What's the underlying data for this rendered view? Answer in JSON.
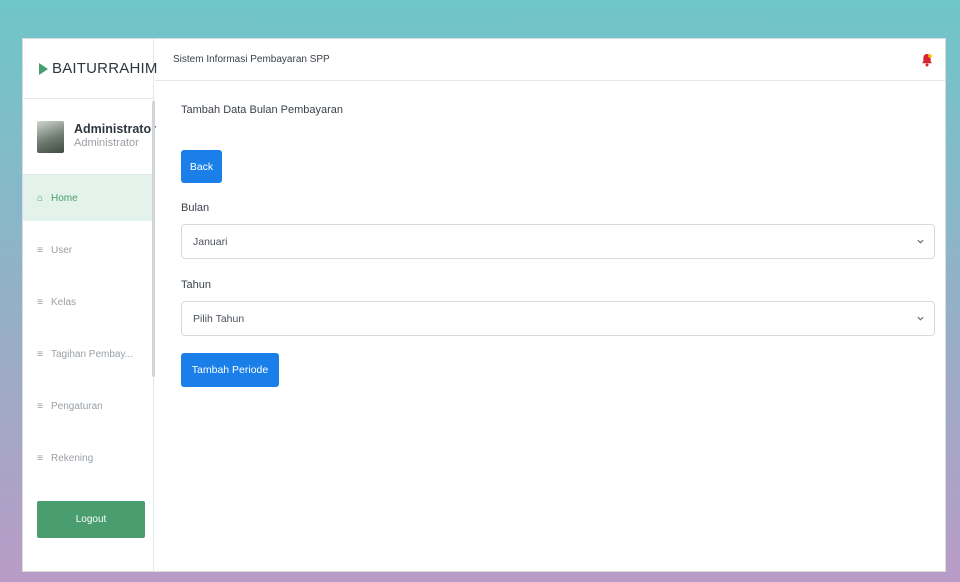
{
  "sidebar": {
    "brand": "BAITURRAHIM",
    "profile": {
      "name": "Administrator",
      "role": "Administrator"
    },
    "items": [
      {
        "label": "Home",
        "icon": "home-icon",
        "active": true
      },
      {
        "label": "User",
        "icon": "menu-lines-icon",
        "active": false
      },
      {
        "label": "Kelas",
        "icon": "menu-lines-icon",
        "active": false
      },
      {
        "label": "Tagihan Pembay...",
        "icon": "menu-lines-icon",
        "active": false
      },
      {
        "label": "Pengaturan",
        "icon": "menu-lines-icon",
        "active": false
      },
      {
        "label": "Rekening",
        "icon": "menu-lines-icon",
        "active": false
      }
    ],
    "logout_label": "Logout"
  },
  "topbar": {
    "title": "Sistem Informasi Pembayaran SPP",
    "notification_icon": "bell-icon"
  },
  "main": {
    "page_title": "Tambah Data Bulan Pembayaran",
    "back_label": "Back",
    "fields": {
      "bulan": {
        "label": "Bulan",
        "value": "Januari"
      },
      "tahun": {
        "label": "Tahun",
        "value": "Pilih Tahun"
      }
    },
    "submit_label": "Tambah Periode"
  },
  "colors": {
    "accent_green": "#4a9d6f",
    "active_bg": "#e3f2ea",
    "primary_blue": "#1a7fe8",
    "bell_red": "#d9232e"
  }
}
